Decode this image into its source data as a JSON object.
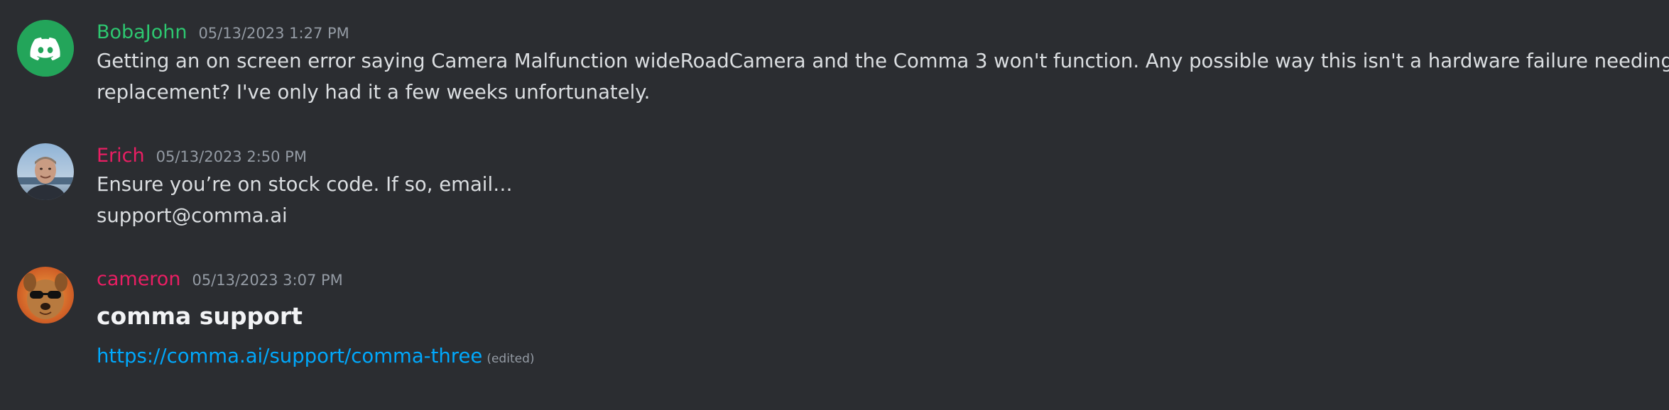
{
  "messages": [
    {
      "username": "BobaJohn",
      "username_color": "#2dc770",
      "timestamp": "05/13/2023 1:27 PM",
      "avatar_icon": "discord-logo-icon",
      "lines": [
        "Getting an on screen error saying Camera Malfunction wideRoadCamera and the Comma 3 won't function. Any possible way this isn't a hardware failure needing a",
        "replacement? I've only had it a few weeks unfortunately."
      ]
    },
    {
      "username": "Erich",
      "username_color": "#e91e63",
      "timestamp": "05/13/2023 2:50 PM",
      "avatar_icon": "user-photo-avatar",
      "lines": [
        "Ensure you’re on stock code.  If so, email…",
        "support@comma.ai"
      ]
    },
    {
      "username": "cameron",
      "username_color": "#e91e63",
      "timestamp": "05/13/2023 3:07 PM",
      "avatar_icon": "dog-sunglasses-avatar",
      "heading": "comma support",
      "link": "https://comma.ai/support/comma-three",
      "edited": "(edited)"
    }
  ],
  "colors": {
    "background": "#2b2d31",
    "text": "#dbdee1",
    "timestamp": "#949ba4",
    "link": "#00a8fc"
  }
}
